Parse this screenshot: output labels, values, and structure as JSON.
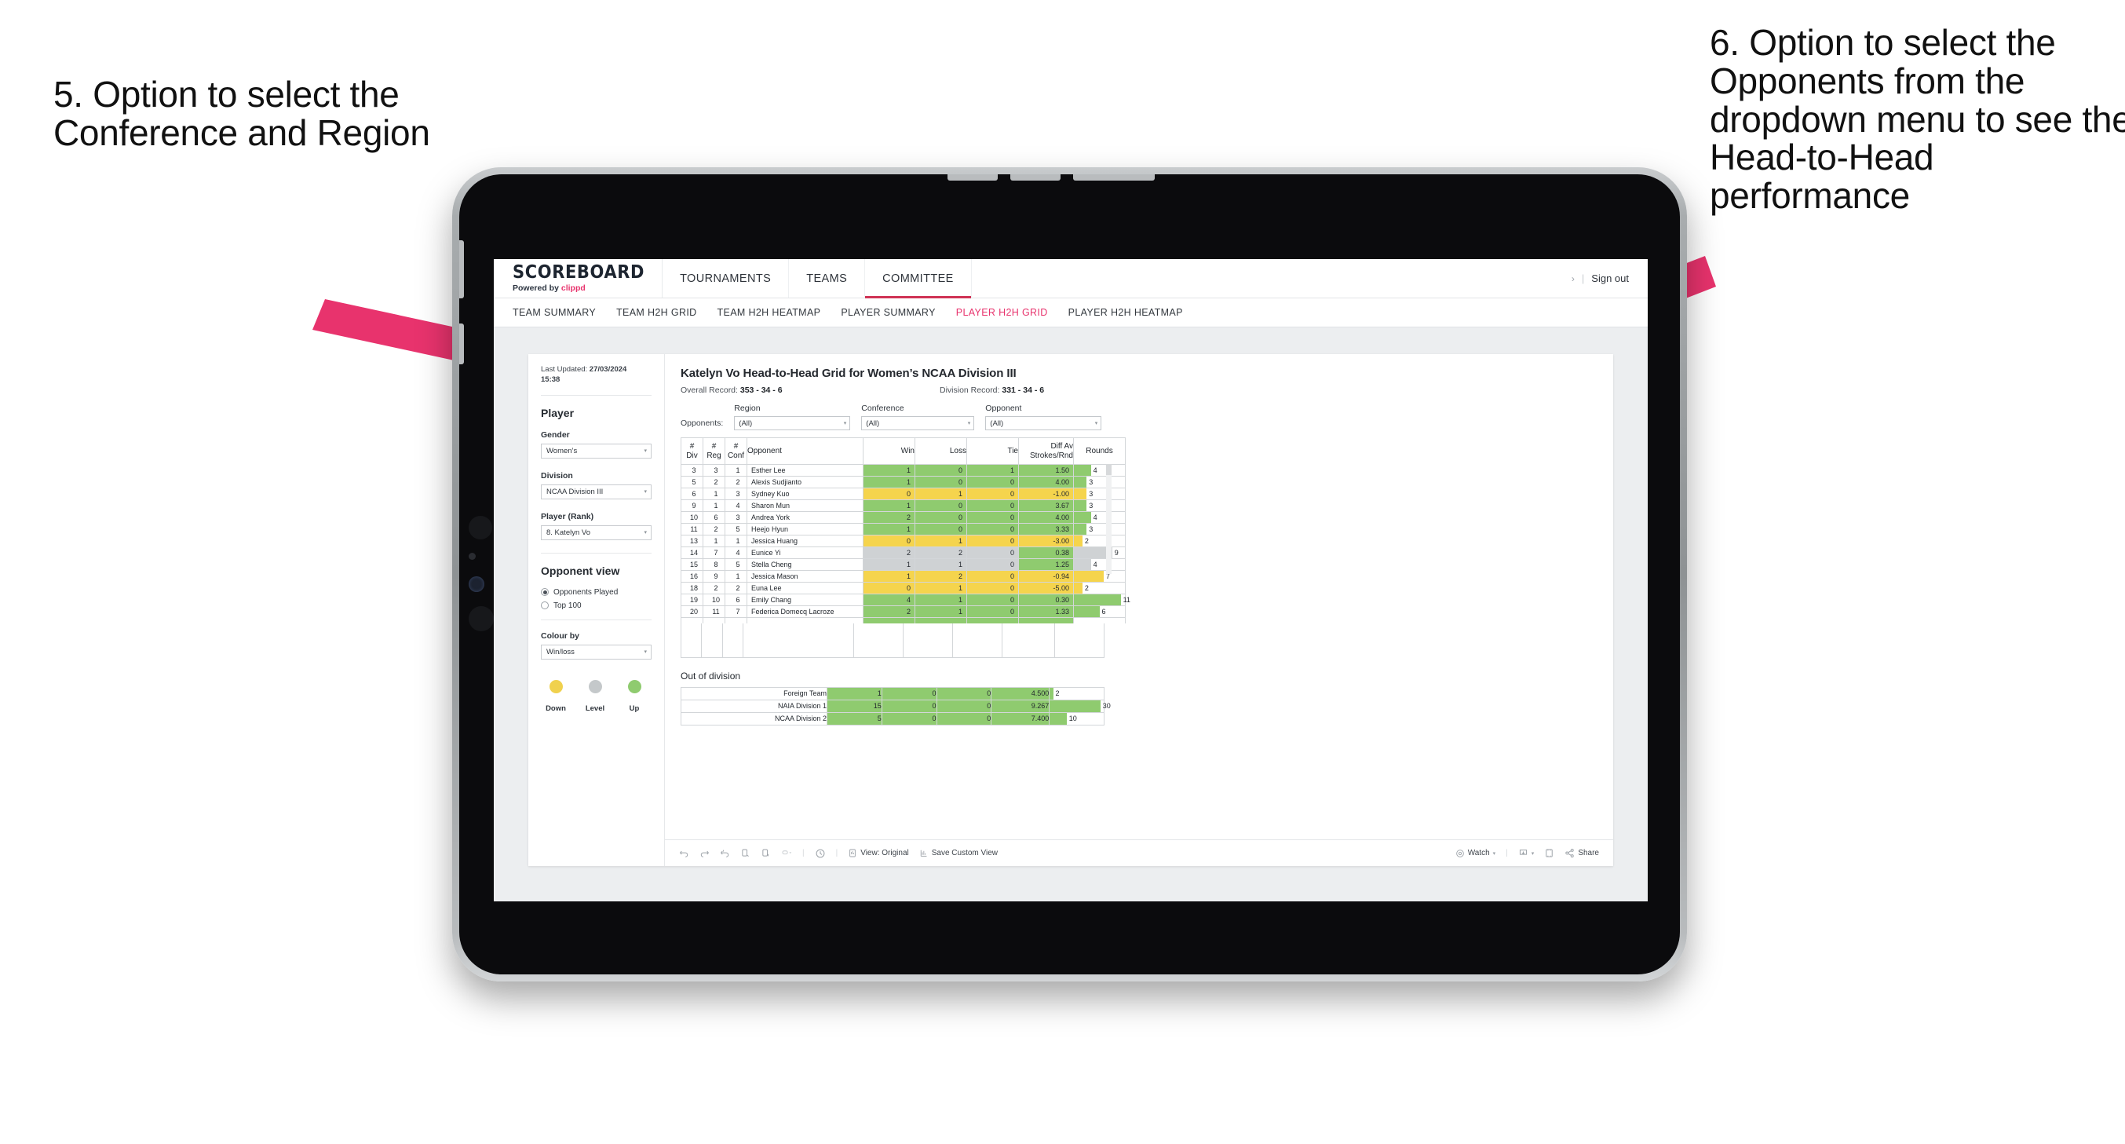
{
  "annotations": {
    "left": "5. Option to select the Conference and Region",
    "right": "6. Option to select the Opponents from the dropdown menu to see the Head-to-Head performance"
  },
  "colors": {
    "accent": "#e8336d",
    "active_tab": "#cf3355",
    "green": "#8fcb6f",
    "yellow": "#f5d44d",
    "grey": "#cfd2d4",
    "arrow": "#ea २336d"
  },
  "topnav": {
    "brand_title": "SCOREBOARD",
    "brand_powered": "Powered by ",
    "brand_name": "clippd",
    "items": [
      {
        "label": "TOURNAMENTS",
        "active": false
      },
      {
        "label": "TEAMS",
        "active": false
      },
      {
        "label": "COMMITTEE",
        "active": true
      }
    ],
    "chevron": "›",
    "separator": "|",
    "signout": "Sign out"
  },
  "subnav": {
    "items": [
      {
        "label": "TEAM SUMMARY",
        "active": false
      },
      {
        "label": "TEAM H2H GRID",
        "active": false
      },
      {
        "label": "TEAM H2H HEATMAP",
        "active": false
      },
      {
        "label": "PLAYER SUMMARY",
        "active": false
      },
      {
        "label": "PLAYER H2H GRID",
        "active": true
      },
      {
        "label": "PLAYER H2H HEATMAP",
        "active": false
      }
    ]
  },
  "sidebar": {
    "last_updated_label": "Last Updated: ",
    "last_updated_value": "27/03/2024",
    "last_updated_time": "15:38",
    "player_heading": "Player",
    "gender_label": "Gender",
    "gender_value": "Women’s",
    "division_label": "Division",
    "division_value": "NCAA Division III",
    "player_rank_label": "Player (Rank)",
    "player_rank_value": "8. Katelyn Vo",
    "opponent_view_heading": "Opponent view",
    "opponent_view_options": [
      {
        "label": "Opponents Played",
        "selected": true
      },
      {
        "label": "Top 100",
        "selected": false
      }
    ],
    "colour_by_label": "Colour by",
    "colour_by_value": "Win/loss",
    "legend": [
      {
        "label": "Down",
        "color": "#f0d14e"
      },
      {
        "label": "Level",
        "color": "#c4c8ca"
      },
      {
        "label": "Up",
        "color": "#8fcb6f"
      }
    ],
    "caret": "▾"
  },
  "main": {
    "title": "Katelyn Vo Head-to-Head Grid for Women’s NCAA Division III",
    "overall_record_label": "Overall Record: ",
    "overall_record_value": "353 - 34 - 6",
    "division_record_label": "Division Record: ",
    "division_record_value": "331 - 34 - 6",
    "opponents_label": "Opponents:",
    "filters": [
      {
        "label": "Region",
        "value": "(All)"
      },
      {
        "label": "Conference",
        "value": "(All)"
      },
      {
        "label": "Opponent",
        "value": "(All)"
      }
    ],
    "caret": "▾",
    "out_of_division_title": "Out of division"
  },
  "chart_data": {
    "type": "table",
    "title": "Katelyn Vo Head-to-Head Grid for Women’s NCAA Division III",
    "columns": [
      "# Div",
      "# Reg",
      "# Conf",
      "Opponent",
      "Win",
      "Loss",
      "Tie",
      "Diff Av Strokes/Rnd",
      "Rounds"
    ],
    "header_lines": [
      [
        "#",
        "Div"
      ],
      [
        "#",
        "Reg"
      ],
      [
        "#",
        "Conf"
      ],
      [
        "",
        "Opponent"
      ],
      [
        "",
        "Win"
      ],
      [
        "",
        "Loss"
      ],
      [
        "",
        "Tie"
      ],
      [
        "Diff Av",
        "Strokes/Rnd"
      ],
      [
        "",
        "Rounds"
      ]
    ],
    "rounds_max": 12,
    "rows": [
      {
        "div": "3",
        "reg": "3",
        "conf": "1",
        "opponent": "Esther Lee",
        "win": "1",
        "loss": "0",
        "tie": "1",
        "diff": "1.50",
        "rounds": "4",
        "rounds_num": 4,
        "color": "green"
      },
      {
        "div": "5",
        "reg": "2",
        "conf": "2",
        "opponent": "Alexis Sudjianto",
        "win": "1",
        "loss": "0",
        "tie": "0",
        "diff": "4.00",
        "rounds": "3",
        "rounds_num": 3,
        "color": "green"
      },
      {
        "div": "6",
        "reg": "1",
        "conf": "3",
        "opponent": "Sydney Kuo",
        "win": "0",
        "loss": "1",
        "tie": "0",
        "diff": "-1.00",
        "rounds": "3",
        "rounds_num": 3,
        "color": "yellow"
      },
      {
        "div": "9",
        "reg": "1",
        "conf": "4",
        "opponent": "Sharon Mun",
        "win": "1",
        "loss": "0",
        "tie": "0",
        "diff": "3.67",
        "rounds": "3",
        "rounds_num": 3,
        "color": "green"
      },
      {
        "div": "10",
        "reg": "6",
        "conf": "3",
        "opponent": "Andrea York",
        "win": "2",
        "loss": "0",
        "tie": "0",
        "diff": "4.00",
        "rounds": "4",
        "rounds_num": 4,
        "color": "green"
      },
      {
        "div": "11",
        "reg": "2",
        "conf": "5",
        "opponent": "Heejo Hyun",
        "win": "1",
        "loss": "0",
        "tie": "0",
        "diff": "3.33",
        "rounds": "3",
        "rounds_num": 3,
        "color": "green"
      },
      {
        "div": "13",
        "reg": "1",
        "conf": "1",
        "opponent": "Jessica Huang",
        "win": "0",
        "loss": "1",
        "tie": "0",
        "diff": "-3.00",
        "rounds": "2",
        "rounds_num": 2,
        "color": "yellow"
      },
      {
        "div": "14",
        "reg": "7",
        "conf": "4",
        "opponent": "Eunice Yi",
        "win": "2",
        "loss": "2",
        "tie": "0",
        "diff": "0.38",
        "rounds": "9",
        "rounds_num": 9,
        "color": "grey",
        "diff_color": "green"
      },
      {
        "div": "15",
        "reg": "8",
        "conf": "5",
        "opponent": "Stella Cheng",
        "win": "1",
        "loss": "1",
        "tie": "0",
        "diff": "1.25",
        "rounds": "4",
        "rounds_num": 4,
        "color": "grey",
        "diff_color": "green"
      },
      {
        "div": "16",
        "reg": "9",
        "conf": "1",
        "opponent": "Jessica Mason",
        "win": "1",
        "loss": "2",
        "tie": "0",
        "diff": "-0.94",
        "rounds": "7",
        "rounds_num": 7,
        "color": "yellow"
      },
      {
        "div": "18",
        "reg": "2",
        "conf": "2",
        "opponent": "Euna Lee",
        "win": "0",
        "loss": "1",
        "tie": "0",
        "diff": "-5.00",
        "rounds": "2",
        "rounds_num": 2,
        "color": "yellow"
      },
      {
        "div": "19",
        "reg": "10",
        "conf": "6",
        "opponent": "Emily Chang",
        "win": "4",
        "loss": "1",
        "tie": "0",
        "diff": "0.30",
        "rounds": "11",
        "rounds_num": 11,
        "color": "green"
      },
      {
        "div": "20",
        "reg": "11",
        "conf": "7",
        "opponent": "Federica Domecq Lacroze",
        "win": "2",
        "loss": "1",
        "tie": "0",
        "diff": "1.33",
        "rounds": "6",
        "rounds_num": 6,
        "color": "green"
      }
    ],
    "out_of_division": {
      "title": "Out of division",
      "rounds_max": 32,
      "rows": [
        {
          "name": "Foreign Team",
          "win": "1",
          "loss": "0",
          "tie": "0",
          "diff": "4.500",
          "rounds": "2",
          "rounds_num": 2,
          "color": "green"
        },
        {
          "name": "NAIA Division 1",
          "win": "15",
          "loss": "0",
          "tie": "0",
          "diff": "9.267",
          "rounds": "30",
          "rounds_num": 30,
          "color": "green"
        },
        {
          "name": "NCAA Division 2",
          "win": "5",
          "loss": "0",
          "tie": "0",
          "diff": "7.400",
          "rounds": "10",
          "rounds_num": 10,
          "color": "green"
        }
      ]
    }
  },
  "toolbar": {
    "view_label": "View: Original",
    "save_label": "Save Custom View",
    "watch_label": "Watch",
    "share_label": "Share",
    "caret": "▾",
    "separator": "|"
  }
}
